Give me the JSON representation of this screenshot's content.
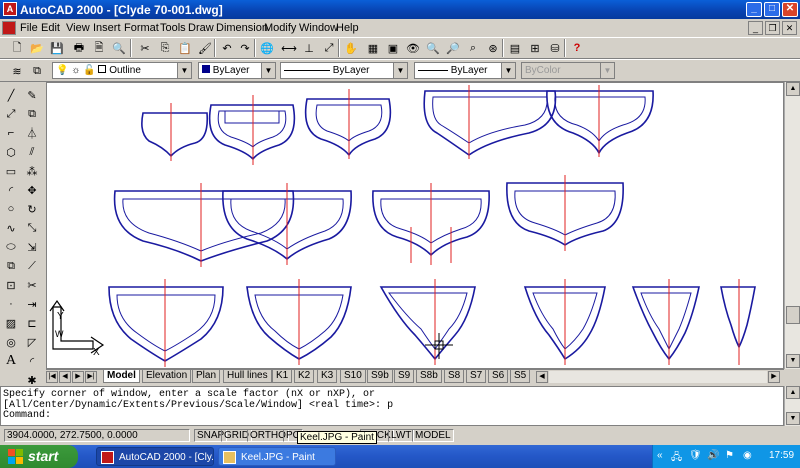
{
  "window": {
    "title": "AutoCAD 2000 - [Clyde 70-001.dwg]"
  },
  "menu": [
    "File",
    "Edit",
    "View",
    "Insert",
    "Format",
    "Tools",
    "Draw",
    "Dimension",
    "Modify",
    "Window",
    "Help"
  ],
  "properties": {
    "layer": "Outline",
    "color": "ByLayer",
    "linetype": "ByLayer",
    "lineweight": "ByLayer",
    "plotstyle": "ByColor"
  },
  "tabs": [
    "Model",
    "Elevation",
    "Plan",
    "Hull lines",
    "K1",
    "K2",
    "K3",
    "S10",
    "S9b",
    "S9",
    "S8b",
    "S8",
    "S7",
    "S6",
    "S5"
  ],
  "command": {
    "line1": "Specify corner of window, enter a scale factor (nX or nXP), or",
    "line2": "[All/Center/Dynamic/Extents/Previous/Scale/Window] <real time>: p",
    "line3": "Command:"
  },
  "status": {
    "coords": "3904.0000, 272.7500, 0.0000",
    "toggles": [
      "SNAP",
      "GRID",
      "ORTHO",
      "PO",
      "RACK",
      "LWT",
      "MODEL"
    ]
  },
  "tooltip": "Keel.JPG - Paint",
  "taskbar": {
    "start": "start",
    "tasks": [
      "AutoCAD 2000 - [Cly...",
      "Keel.JPG - Paint"
    ],
    "clock": "17:59"
  },
  "ucs": {
    "x": "X",
    "y": "Y",
    "w": "W"
  },
  "colors": {
    "hull": "#1a1aa0",
    "centerline": "#e02020",
    "canvas": "#ffffff"
  }
}
